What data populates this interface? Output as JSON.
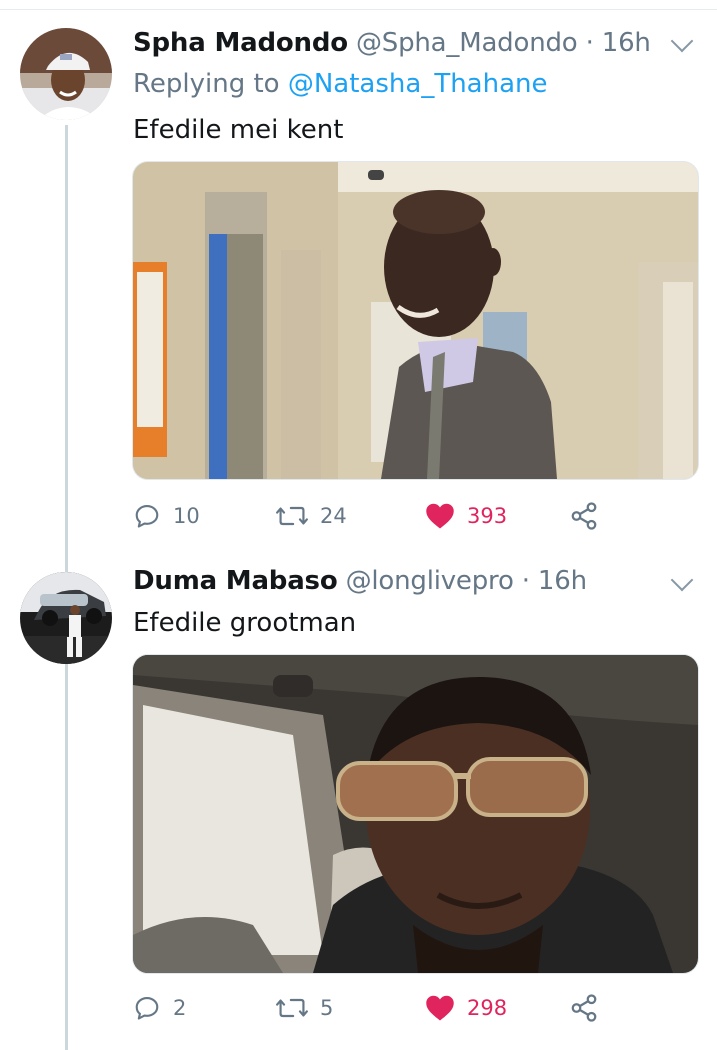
{
  "tweets": [
    {
      "display_name": "Spha Madondo",
      "handle": "@Spha_Madondo",
      "separator": "·",
      "time": "16h",
      "replying_to_prefix": "Replying to ",
      "replying_to": "@Natasha_Thahane",
      "text": "Efedile mei kent",
      "counts": {
        "replies": "10",
        "retweets": "24",
        "likes": "393"
      }
    },
    {
      "display_name": "Duma Mabaso",
      "handle": "@longlivepro",
      "separator": "·",
      "time": "16h",
      "text": "Efedile grootman",
      "counts": {
        "replies": "2",
        "retweets": "5",
        "likes": "298"
      }
    }
  ],
  "icons": {
    "reply": "reply-icon",
    "retweet": "retweet-icon",
    "like": "heart-icon-filled",
    "share": "share-icon",
    "caret": "chevron-down-icon"
  },
  "colors": {
    "like_active": "#e0245e",
    "link": "#1da1f2",
    "muted": "#657786",
    "thread_line": "#ccd6dd"
  }
}
